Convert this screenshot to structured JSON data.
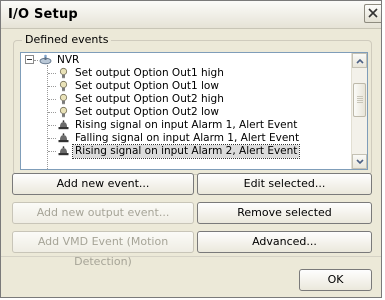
{
  "window": {
    "title": "I/O Setup"
  },
  "group": {
    "label": "Defined events"
  },
  "tree": {
    "root": {
      "label": "NVR",
      "icon": "network-device-icon"
    },
    "items": [
      {
        "label": "Set output Option Out1 high",
        "icon": "output-bulb-icon"
      },
      {
        "label": "Set output Option Out1 low",
        "icon": "output-bulb-icon"
      },
      {
        "label": "Set output Option Out2 high",
        "icon": "output-bulb-icon"
      },
      {
        "label": "Set output Option Out2 low",
        "icon": "output-bulb-icon"
      },
      {
        "label": "Rising signal on input Alarm 1, Alert Event",
        "icon": "input-alarm-icon"
      },
      {
        "label": "Falling signal on input Alarm 1, Alert Event",
        "icon": "input-alarm-icon"
      },
      {
        "label": "Rising signal on input Alarm 2, Alert Event",
        "icon": "input-alarm-icon",
        "selected": true
      }
    ]
  },
  "buttons": {
    "add_new_event": "Add new event...",
    "edit_selected": "Edit selected...",
    "add_new_output_event": "Add new output event...",
    "remove_selected": "Remove selected",
    "add_vmd_event": "Add VMD Event (Motion Detection)",
    "advanced": "Advanced...",
    "ok": "OK"
  }
}
